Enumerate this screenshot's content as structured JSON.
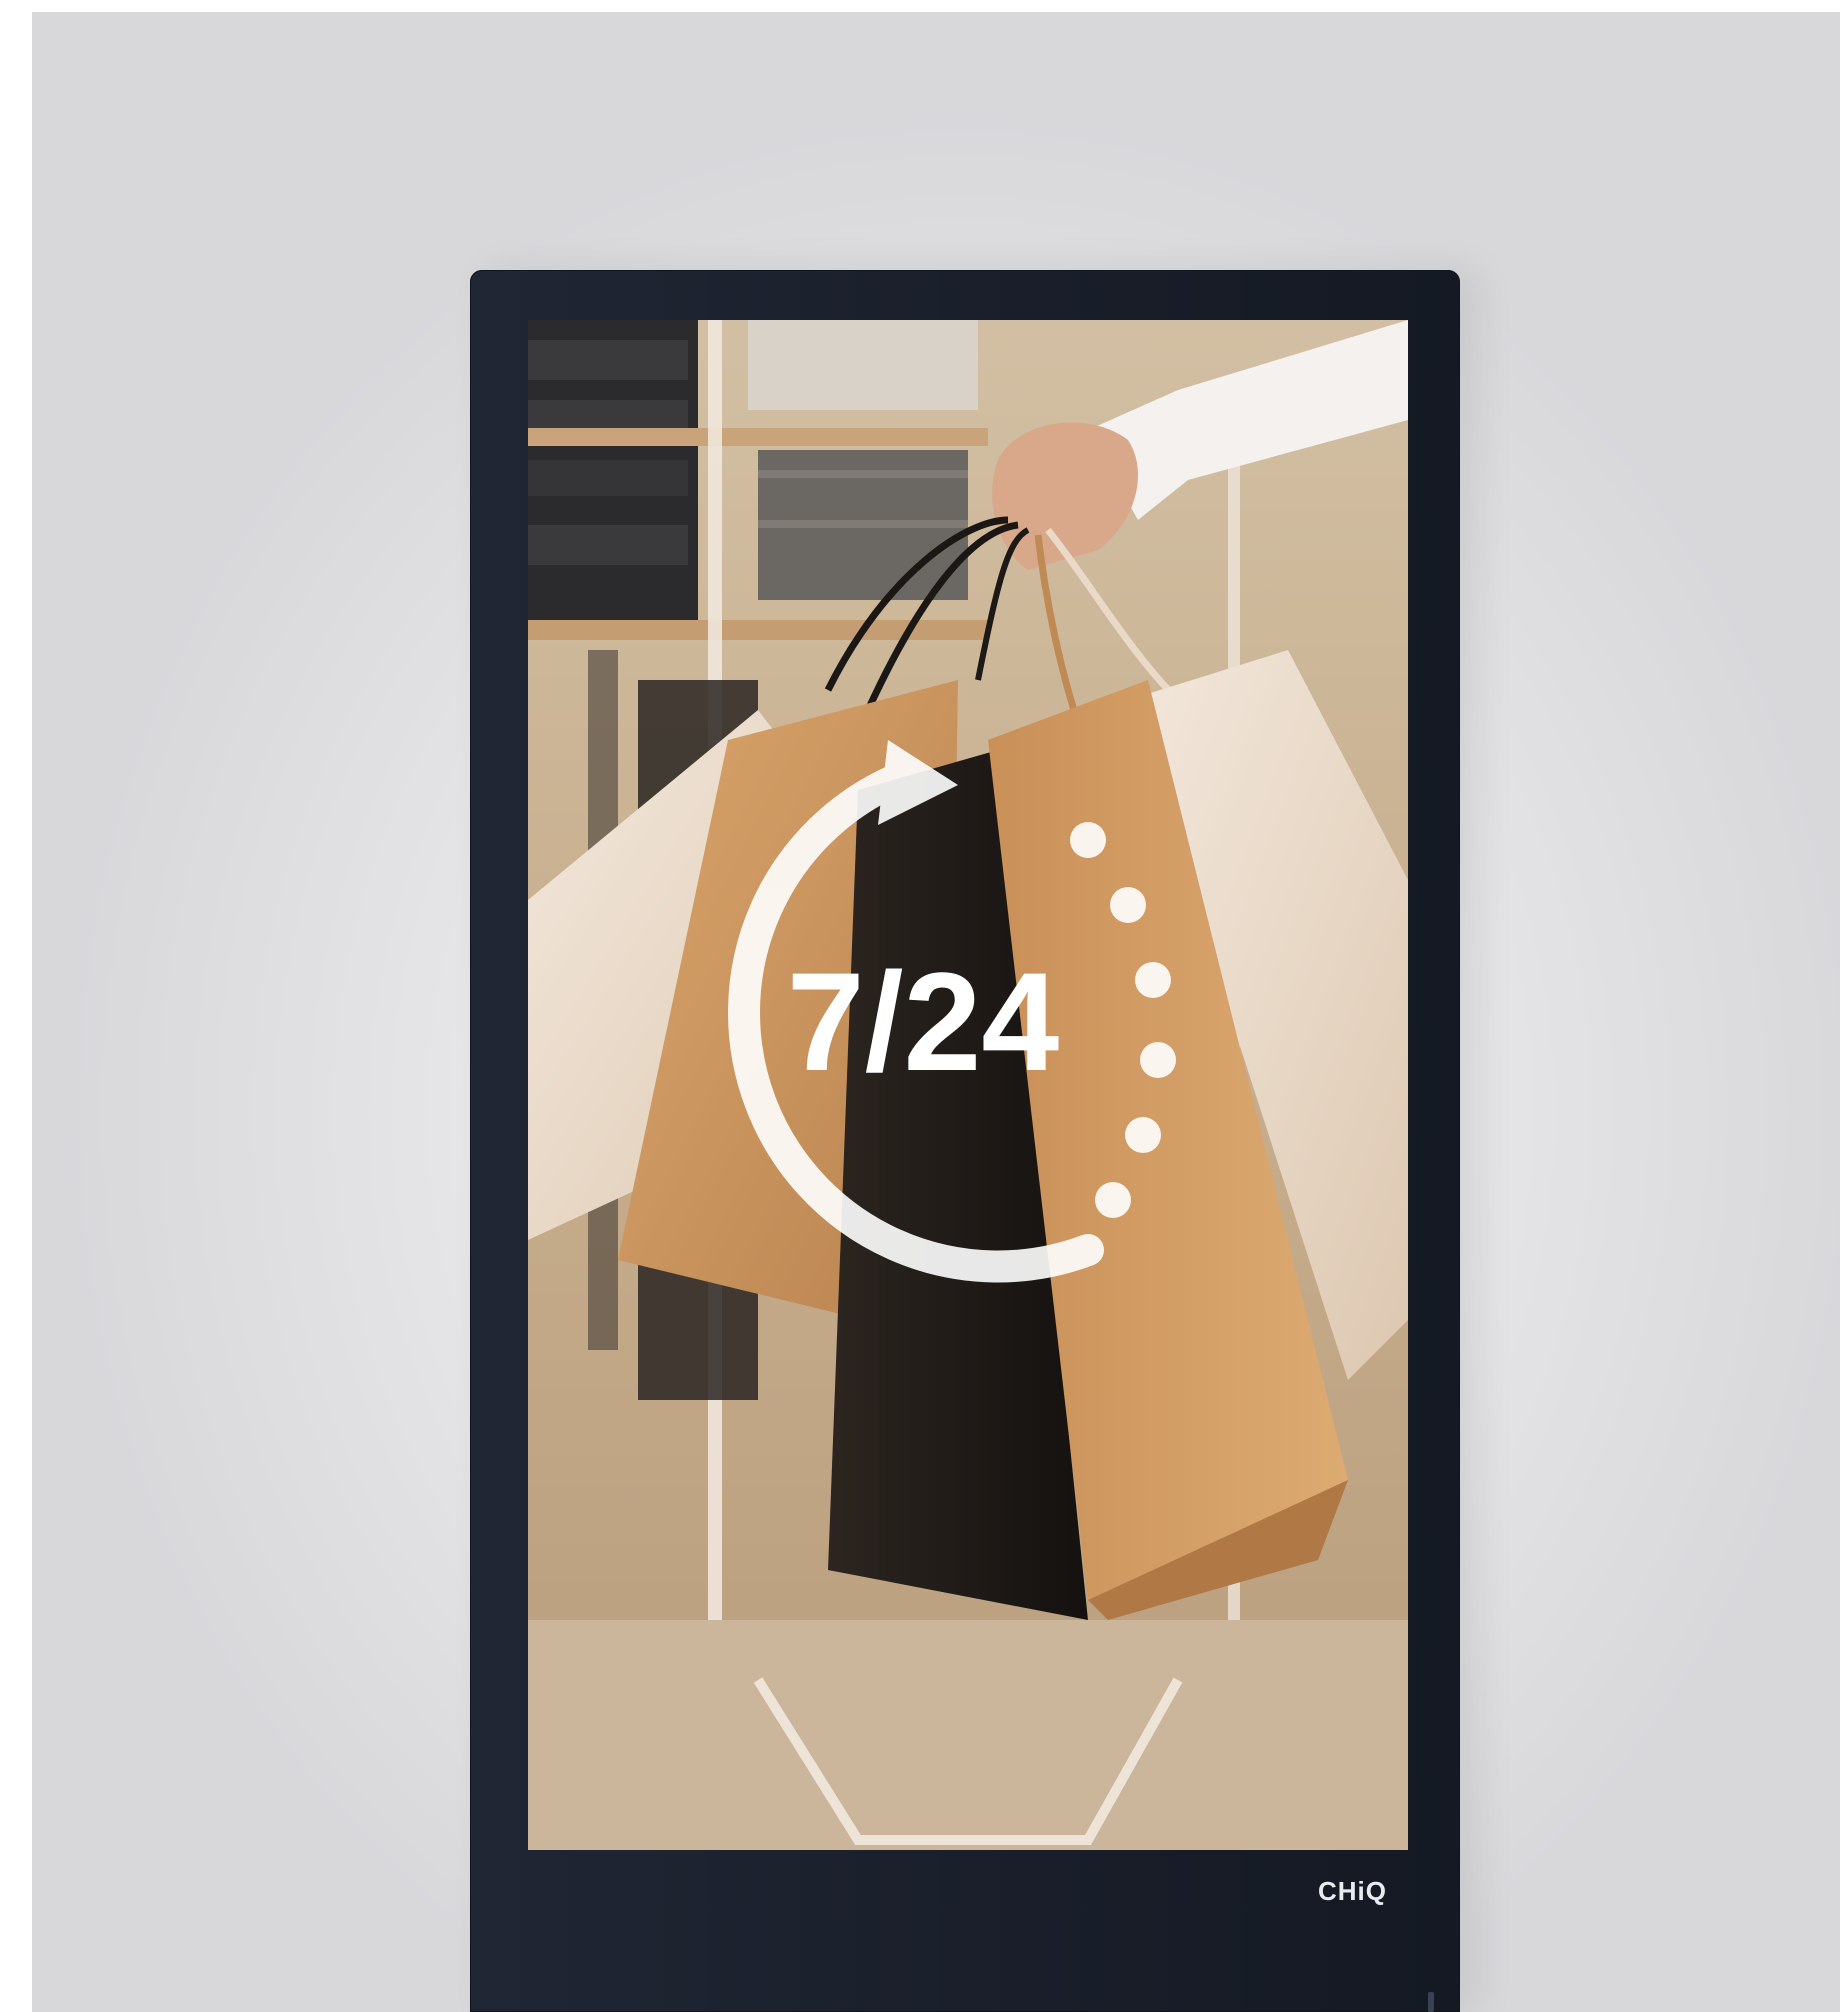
{
  "display": {
    "brand": "CHiQ",
    "overlay_text": "7/24",
    "icons": [
      "clock-rotate-icon"
    ],
    "colors": {
      "bezel": "#1b202c",
      "backdrop": "#e4e4e6",
      "overlay": "#ffffff"
    }
  }
}
